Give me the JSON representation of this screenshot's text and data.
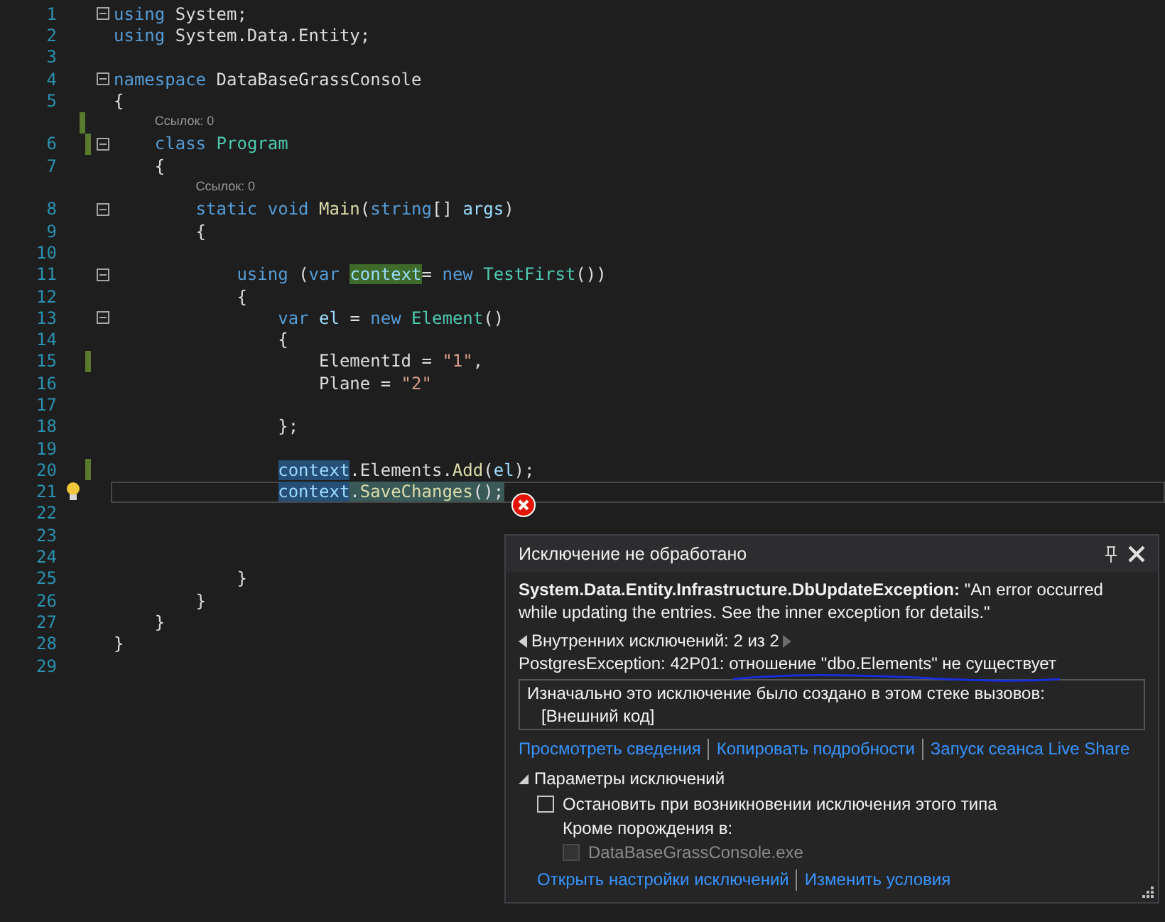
{
  "editor": {
    "lines": [
      {
        "kind": "code",
        "number": "1",
        "collapsible": true,
        "tokens": [
          {
            "text": "using",
            "kind": "keyword"
          },
          {
            "text": " System;",
            "kind": "plain"
          }
        ]
      },
      {
        "kind": "code",
        "number": "2",
        "tokens": [
          {
            "text": "using",
            "kind": "keyword"
          },
          {
            "text": " System.Data.Entity;",
            "kind": "plain"
          }
        ]
      },
      {
        "kind": "code",
        "number": "3"
      },
      {
        "kind": "code",
        "number": "4",
        "collapsible": true,
        "tokens": [
          {
            "text": "namespace",
            "kind": "keyword"
          },
          {
            "text": " DataBaseGrassConsole",
            "kind": "plain"
          }
        ]
      },
      {
        "kind": "code",
        "number": "5",
        "tokens": [
          {
            "text": "{",
            "kind": "plain"
          }
        ]
      },
      {
        "kind": "codelens",
        "text": "Ссылок: 0",
        "changed": true
      },
      {
        "kind": "code",
        "number": "6",
        "collapsible": true,
        "changed": true,
        "tokens": [
          {
            "text": "    class ",
            "kind": "keyword"
          },
          {
            "text": "Program",
            "kind": "type"
          }
        ]
      },
      {
        "kind": "code",
        "number": "7",
        "tokens": [
          {
            "text": "    {",
            "kind": "plain"
          }
        ]
      },
      {
        "kind": "codelens",
        "text": "Ссылок: 0"
      },
      {
        "kind": "code",
        "number": "8",
        "collapsible": true,
        "tokens": [
          {
            "text": "        static void ",
            "kind": "keyword"
          },
          {
            "text": "Main",
            "kind": "method"
          },
          {
            "text": "(",
            "kind": "plain"
          },
          {
            "text": "string",
            "kind": "keyword"
          },
          {
            "text": "[] ",
            "kind": "plain"
          },
          {
            "text": "args",
            "kind": "param"
          },
          {
            "text": ")",
            "kind": "plain"
          }
        ]
      },
      {
        "kind": "code",
        "number": "9",
        "tokens": [
          {
            "text": "        {",
            "kind": "plain"
          }
        ]
      },
      {
        "kind": "code",
        "number": "10"
      },
      {
        "kind": "code",
        "number": "11",
        "collapsible": true,
        "tokens": [
          {
            "text": "            using",
            "kind": "keyword"
          },
          {
            "text": " (",
            "kind": "plain"
          },
          {
            "text": "var ",
            "kind": "keyword"
          },
          {
            "text": "context",
            "kind": "param",
            "reference_highlight": true
          },
          {
            "text": "= ",
            "kind": "plain"
          },
          {
            "text": "new ",
            "kind": "keyword"
          },
          {
            "text": "TestFirst",
            "kind": "type"
          },
          {
            "text": "())",
            "kind": "plain"
          }
        ]
      },
      {
        "kind": "code",
        "number": "12",
        "tokens": [
          {
            "text": "            {",
            "kind": "plain"
          }
        ]
      },
      {
        "kind": "code",
        "number": "13",
        "collapsible": true,
        "tokens": [
          {
            "text": "                var ",
            "kind": "keyword"
          },
          {
            "text": "el",
            "kind": "param"
          },
          {
            "text": " = ",
            "kind": "plain"
          },
          {
            "text": "new ",
            "kind": "keyword"
          },
          {
            "text": "Element",
            "kind": "type"
          },
          {
            "text": "()",
            "kind": "plain"
          }
        ]
      },
      {
        "kind": "code",
        "number": "14",
        "tokens": [
          {
            "text": "                {",
            "kind": "plain"
          }
        ]
      },
      {
        "kind": "code",
        "number": "15",
        "changed": true,
        "tokens": [
          {
            "text": "                    ElementId = ",
            "kind": "plain"
          },
          {
            "text": "\"1\"",
            "kind": "string"
          },
          {
            "text": ",",
            "kind": "plain"
          }
        ]
      },
      {
        "kind": "code",
        "number": "16",
        "tokens": [
          {
            "text": "                    Plane = ",
            "kind": "plain"
          },
          {
            "text": "\"2\"",
            "kind": "string"
          }
        ]
      },
      {
        "kind": "code",
        "number": "17"
      },
      {
        "kind": "code",
        "number": "18",
        "tokens": [
          {
            "text": "                };",
            "kind": "plain"
          }
        ]
      },
      {
        "kind": "code",
        "number": "19"
      },
      {
        "kind": "code",
        "number": "20",
        "changed": true,
        "tokens": [
          {
            "text": "                context",
            "kind": "param",
            "selected": true
          },
          {
            "text": ".Elements.",
            "kind": "plain"
          },
          {
            "text": "Add",
            "kind": "method"
          },
          {
            "text": "(",
            "kind": "plain"
          },
          {
            "text": "el",
            "kind": "param"
          },
          {
            "text": ");",
            "kind": "plain"
          }
        ]
      },
      {
        "kind": "code",
        "number": "21",
        "lightbulb": true,
        "current": true,
        "tokens": [
          {
            "text": "                context",
            "kind": "param",
            "selected": true
          },
          {
            "text": ".",
            "kind": "plain",
            "current_statement": true
          },
          {
            "text": "SaveChanges",
            "kind": "method",
            "current_statement": true
          },
          {
            "text": "();",
            "kind": "plain",
            "current_statement": true
          }
        ]
      },
      {
        "kind": "code",
        "number": "22"
      },
      {
        "kind": "code",
        "number": "23"
      },
      {
        "kind": "code",
        "number": "24"
      },
      {
        "kind": "code",
        "number": "25",
        "tokens": [
          {
            "text": "            }",
            "kind": "plain"
          }
        ]
      },
      {
        "kind": "code",
        "number": "26",
        "tokens": [
          {
            "text": "        }",
            "kind": "plain"
          }
        ]
      },
      {
        "kind": "code",
        "number": "27",
        "tokens": [
          {
            "text": "    }",
            "kind": "plain"
          }
        ]
      },
      {
        "kind": "code",
        "number": "28",
        "tokens": [
          {
            "text": "}",
            "kind": "plain"
          }
        ]
      },
      {
        "kind": "code",
        "number": "29"
      }
    ]
  },
  "exception_popup": {
    "title": "Исключение не обработано",
    "message": "**System.Data.Entity.Infrastructure.DbUpdateException:** \"An error occurred while updating the entries. See the inner exception for details.\"",
    "inner_nav": "Внутренних исключений: 2 из 2",
    "inner_message": "PostgresException: 42P01: отношение \"dbo.Elements\" не существует",
    "stack": {
      "title": "Изначально это исключение было создано в этом стеке вызовов:",
      "frames": [
        "[Внешний код]"
      ]
    },
    "links": [
      "Просмотреть сведения",
      "Копировать подробности",
      "Запуск сеанса Live Share"
    ],
    "settings": {
      "title": "Параметры исключений",
      "expanded": true,
      "option": {
        "label": "Остановить при возникновении исключения этого типа",
        "checked": false
      },
      "except_label": "Кроме порождения в:",
      "modules": [
        {
          "label": "DataBaseGrassConsole.exe",
          "checked": false,
          "disabled": true
        }
      ]
    },
    "bottom_links": [
      "Открыть настройки исключений",
      "Изменить условия"
    ]
  }
}
